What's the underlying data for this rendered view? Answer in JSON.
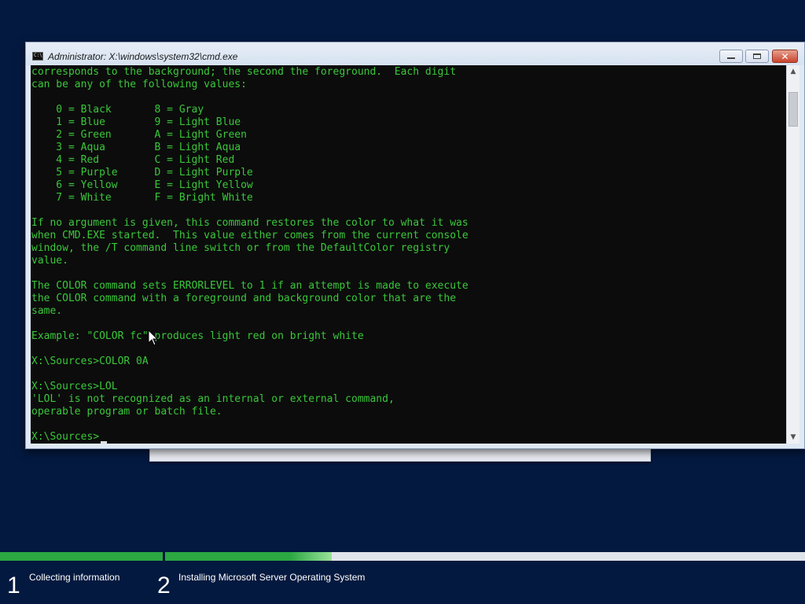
{
  "window": {
    "title": "Administrator: X:\\windows\\system32\\cmd.exe",
    "buttons": {
      "minimize": "minimize-icon",
      "maximize": "maximize-icon",
      "close": "close-icon"
    }
  },
  "console": {
    "text_color": "#3ac73a",
    "background": "#0c0c0c",
    "output": "corresponds to the background; the second the foreground.  Each digit\ncan be any of the following values:\n\n    0 = Black       8 = Gray\n    1 = Blue        9 = Light Blue\n    2 = Green       A = Light Green\n    3 = Aqua        B = Light Aqua\n    4 = Red         C = Light Red\n    5 = Purple      D = Light Purple\n    6 = Yellow      E = Light Yellow\n    7 = White       F = Bright White\n\nIf no argument is given, this command restores the color to what it was\nwhen CMD.EXE started.  This value either comes from the current console\nwindow, the /T command line switch or from the DefaultColor registry\nvalue.\n\nThe COLOR command sets ERRORLEVEL to 1 if an attempt is made to execute\nthe COLOR command with a foreground and background color that are the\nsame.\n\nExample: \"COLOR fc\" produces light red on bright white\n\nX:\\Sources>COLOR 0A\n\nX:\\Sources>LOL\n'LOL' is not recognized as an internal or external command,\noperable program or batch file.\n\nX:\\Sources>"
  },
  "setup": {
    "progress": {
      "step1_complete": 1.0,
      "step2_fraction": 0.26,
      "color": "#2ba842"
    },
    "steps": [
      {
        "number": "1",
        "label": "Collecting information"
      },
      {
        "number": "2",
        "label": "Installing Microsoft Server Operating System"
      }
    ]
  }
}
